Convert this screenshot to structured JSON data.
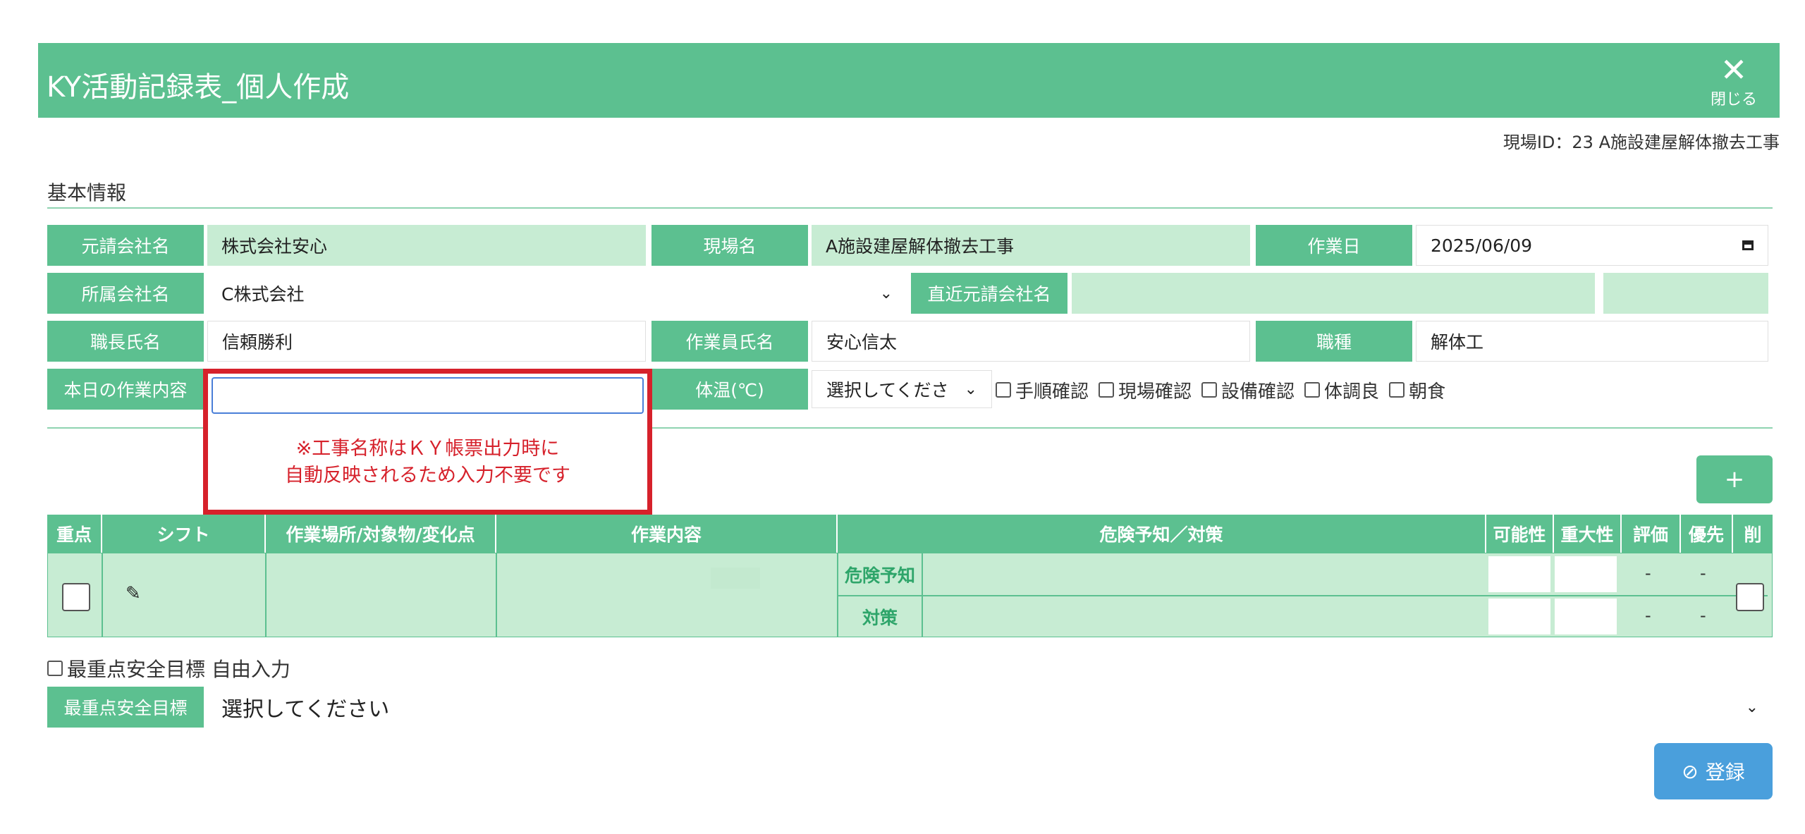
{
  "header": {
    "title": "KY活動記録表_個人作成",
    "close_label": "閉じる"
  },
  "site_id": "現場ID：23 A施設建屋解体撤去工事",
  "section_title": "基本情報",
  "basic": {
    "prime_company_label": "元請会社名",
    "prime_company_value": "株式会社安心",
    "site_name_label": "現場名",
    "site_name_value": "A施設建屋解体撤去工事",
    "work_date_label": "作業日",
    "work_date_value": "2025/06/09",
    "affiliation_label": "所属会社名",
    "affiliation_value": "C株式会社",
    "direct_prime_label": "直近元請会社名",
    "foreman_label": "職長氏名",
    "foreman_value": "信頼勝利",
    "worker_label": "作業員氏名",
    "worker_value": "安心信太",
    "job_label": "職種",
    "job_value": "解体工",
    "today_work_label": "本日の作業内容",
    "temp_label": "体温(℃)",
    "temp_value": "選択してくださ"
  },
  "checks": [
    "手順確認",
    "現場確認",
    "設備確認",
    "体調良",
    "朝食"
  ],
  "callout_note_line1": "※工事名称はＫＹ帳票出力時に",
  "callout_note_line2": "自動反映されるため入力不要です",
  "add_button": "+",
  "table": {
    "headers": [
      "重点",
      "シフト",
      "作業場所/対象物/変化点",
      "作業内容",
      "危険予知／対策",
      "可能性",
      "重大性",
      "評価",
      "優先",
      "削"
    ],
    "row_labels": [
      "危険予知",
      "対策"
    ],
    "dash": "-"
  },
  "goal": {
    "free_input_label": "最重点安全目標 自由入力",
    "label": "最重点安全目標",
    "select_value": "選択してください"
  },
  "submit_label": "登録",
  "colors": {
    "accent": "#5cc090",
    "light": "#c7ecd3",
    "callout": "#d6212b",
    "submit": "#4a9fdc"
  }
}
